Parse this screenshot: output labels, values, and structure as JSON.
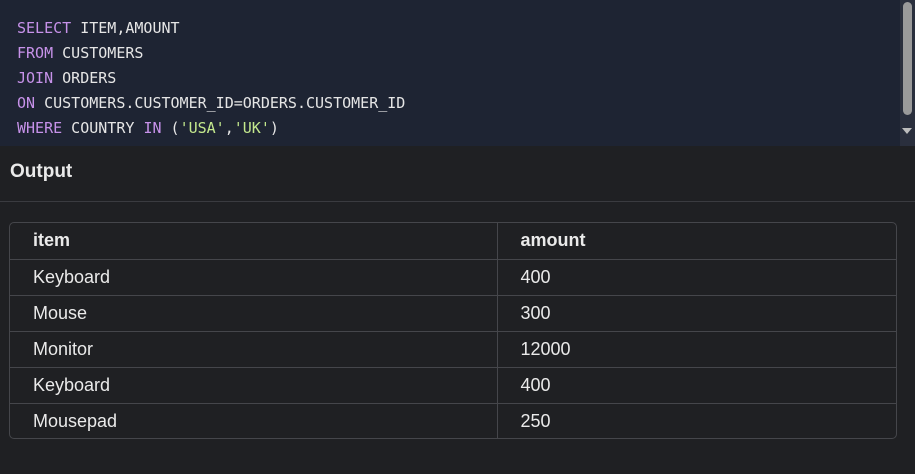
{
  "editor": {
    "lines": [
      [
        {
          "t": "SELECT",
          "c": "kw"
        },
        {
          "t": " ITEM,AMOUNT",
          "c": "plain"
        }
      ],
      [
        {
          "t": "FROM",
          "c": "kw"
        },
        {
          "t": " CUSTOMERS",
          "c": "plain"
        }
      ],
      [
        {
          "t": "JOIN",
          "c": "kw"
        },
        {
          "t": " ORDERS",
          "c": "plain"
        }
      ],
      [
        {
          "t": "ON",
          "c": "kw"
        },
        {
          "t": " CUSTOMERS.CUSTOMER_ID=ORDERS.CUSTOMER_ID",
          "c": "plain"
        }
      ],
      [
        {
          "t": "WHERE",
          "c": "kw"
        },
        {
          "t": " COUNTRY ",
          "c": "plain"
        },
        {
          "t": "IN",
          "c": "kw"
        },
        {
          "t": " (",
          "c": "plain"
        },
        {
          "t": "'USA'",
          "c": "str"
        },
        {
          "t": ",",
          "c": "plain"
        },
        {
          "t": "'UK'",
          "c": "str"
        },
        {
          "t": ")",
          "c": "plain"
        }
      ]
    ]
  },
  "output": {
    "title": "Output",
    "columns": [
      "item",
      "amount"
    ],
    "rows": [
      [
        "Keyboard",
        "400"
      ],
      [
        "Mouse",
        "300"
      ],
      [
        "Monitor",
        "12000"
      ],
      [
        "Keyboard",
        "400"
      ],
      [
        "Mousepad",
        "250"
      ]
    ]
  },
  "colors": {
    "editor_bg": "#1e2433",
    "keyword": "#c792ea",
    "string": "#c3e88d",
    "panel_bg": "#1f2023"
  }
}
